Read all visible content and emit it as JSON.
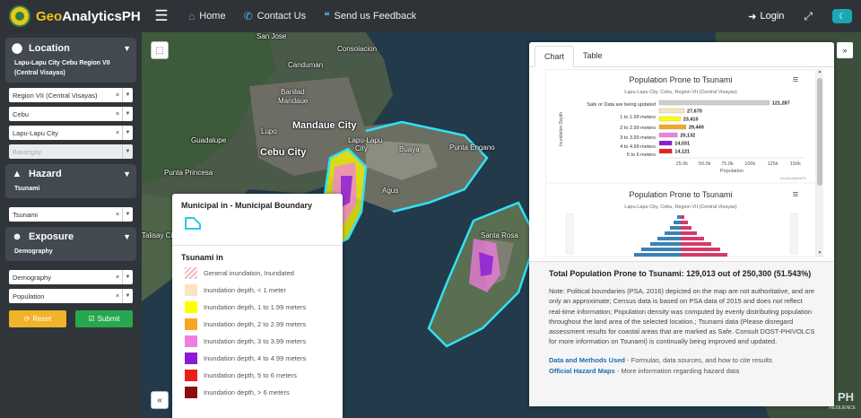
{
  "navbar": {
    "brand_geo": "Geo",
    "brand_rest": "AnalyticsPH",
    "menu_icon": "hamburger-icon",
    "links": [
      {
        "label": "Home",
        "icon": "home-icon"
      },
      {
        "label": "Contact Us",
        "icon": "phone-icon"
      },
      {
        "label": "Send us Feedback",
        "icon": "comments-icon"
      }
    ],
    "login_label": "Login",
    "accent": "#1aa7b6"
  },
  "sidebar": {
    "location": {
      "title": "Location",
      "subtitle": "Lapu-Lapu City Cebu Region VII (Central Visayas)",
      "selects": [
        "Region VII (Central Visayas)",
        "Cebu",
        "Lapu-Lapu City"
      ],
      "barangay_placeholder": "Barangay"
    },
    "hazard": {
      "title": "Hazard",
      "subtitle": "Tsunami",
      "select": "Tsunami"
    },
    "exposure": {
      "title": "Exposure",
      "subtitle": "Demography",
      "selects": [
        "Demography",
        "Population"
      ]
    },
    "reset_label": "Reset",
    "submit_label": "Submit"
  },
  "map": {
    "labels": {
      "san_jose": "San Jose",
      "consolacion": "Consolacion",
      "canduman": "Canduman",
      "banilad": "Banilad",
      "mandaue": "Mandaue",
      "mandaue_city": "Mandaue City",
      "lupo": "Lupo",
      "lapu_lapu": "Lapu-Lapu",
      "city": "City",
      "guadalupe": "Guadalupe",
      "cebu_city": "Cebu City",
      "buaya": "Buaya",
      "punta_engano": "Punta Engano",
      "punta_princesa": "Punta Princesa",
      "agus": "Agus",
      "santa_rosa": "Santa Rosa",
      "talisay_city": "Talisay City"
    },
    "corner_brand": "PH",
    "corner_sub": "RESILIENCE"
  },
  "legend": {
    "boundary_title": "Municipal in - Municipal Boundary",
    "tsunami_title": "Tsunami in",
    "items": [
      {
        "label": "General inundation, Inundated",
        "color": "#f2b8b8"
      },
      {
        "label": "Inundation depth, < 1 meter",
        "color": "#fbe3c3"
      },
      {
        "label": "Inundation depth, 1 to 1.99 meters",
        "color": "#ffff00"
      },
      {
        "label": "Inundation depth, 2 to 2.99 meters",
        "color": "#f5a623"
      },
      {
        "label": "Inundation depth, 3 to 3.99 meters",
        "color": "#f07ee0"
      },
      {
        "label": "Inundation depth, 4 to 4.99 meters",
        "color": "#8a1ad6"
      },
      {
        "label": "Inundation depth, 5 to 6 meters",
        "color": "#e8201c"
      },
      {
        "label": "Inundation depth, > 6 meters",
        "color": "#8b0d0d"
      }
    ]
  },
  "panel": {
    "tabs": [
      "Chart",
      "Table"
    ],
    "total": "Total Population Prone to Tsunami: 129,013 out of 250,300 (51.543%)",
    "note": "Note: Political boundaries (PSA, 2016) depicted on the map are not authoritative, and are only an approximate; Census data is based on PSA data of 2015 and does not reflect real-time information; Population density was computed by evenly distributing population throughout the land area of the selected location.; Tsunami data (Please disregard assessment results for coastal areas that are marked as Safe. Consult DOST-PHIVOLCS for more information on Tsunami) is continually being improved and updated.",
    "link1": "Data and Methods Used",
    "link1_rest": " - Formulas, data sources, and how to cite results",
    "link2": "Official Hazard Maps",
    "link2_rest": " - More information regarding hazard data"
  },
  "chart_data": [
    {
      "type": "bar",
      "title": "Population Prone to Tsunami",
      "subtitle": "Lapu-Lapu City, Cebu, Region VII (Central Visayas)",
      "xlabel": "Population",
      "ylabel": "Inundation Depth",
      "categories": [
        "Safe or Data are being updated",
        "1 to 1.99 meters",
        "2 to 2.99 meters",
        "3 to 3.99 meters",
        "4 to 4.99 meters",
        "5 to 6 meters"
      ],
      "values": [
        121287,
        27670,
        23410,
        29449,
        20132,
        14031,
        14121
      ],
      "data_labels": [
        "121,287",
        "27,670",
        "23,410",
        "29,449",
        "20,132",
        "14,031",
        "14,121"
      ],
      "colors": [
        "#cccccc",
        "#fbe3c3",
        "#ffff00",
        "#f5a623",
        "#f07ee0",
        "#8a1ad6",
        "#e8201c"
      ],
      "x_ticks": [
        "25.0k",
        "50.0k",
        "75.0k",
        "100k",
        "125k",
        "150k"
      ],
      "xlim": [
        0,
        160000
      ],
      "credit": "GeoAnalyticsPH"
    },
    {
      "type": "bar",
      "title": "Population Prone to Tsunami",
      "subtitle": "Lapu-Lapu City, Cebu, Region VII (Central Visayas)"
    }
  ]
}
